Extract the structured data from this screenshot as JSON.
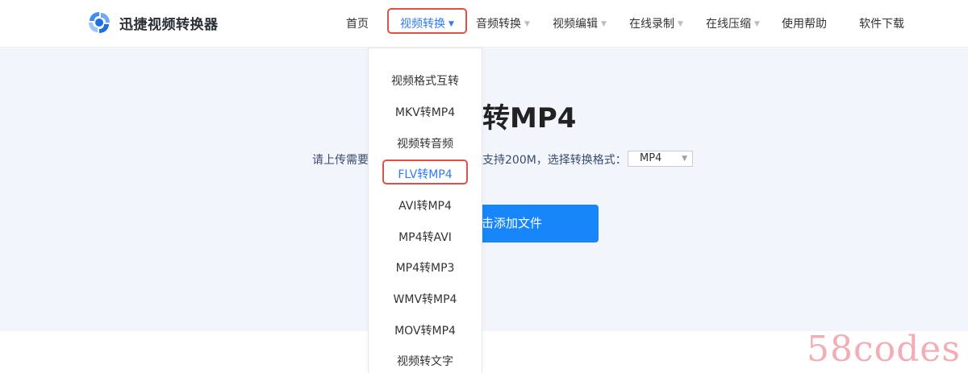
{
  "brand": {
    "name": "迅捷视频转换器",
    "logo_icon": "swirl-logo-icon",
    "accent_color": "#2d7bf0"
  },
  "nav": {
    "items": [
      {
        "label": "首页",
        "has_caret": false,
        "active": false
      },
      {
        "label": "视频转换",
        "has_caret": true,
        "active": true
      },
      {
        "label": "音频转换",
        "has_caret": true,
        "active": false
      },
      {
        "label": "视频编辑",
        "has_caret": true,
        "active": false
      },
      {
        "label": "在线录制",
        "has_caret": true,
        "active": false
      },
      {
        "label": "在线压缩",
        "has_caret": true,
        "active": false
      },
      {
        "label": "使用帮助",
        "has_caret": false,
        "active": false
      },
      {
        "label": "软件下载",
        "has_caret": false,
        "active": false
      }
    ],
    "caret_glyph": "▼"
  },
  "dropdown": {
    "items": [
      {
        "label": "视频格式互转",
        "active": false
      },
      {
        "label": "MKV转MP4",
        "active": false
      },
      {
        "label": "视频转音频",
        "active": false
      },
      {
        "label": "FLV转MP4",
        "active": true
      },
      {
        "label": "AVI转MP4",
        "active": false
      },
      {
        "label": "MP4转AVI",
        "active": false
      },
      {
        "label": "MP4转MP3",
        "active": false
      },
      {
        "label": "WMV转MP4",
        "active": false
      },
      {
        "label": "MOV转MP4",
        "active": false
      },
      {
        "label": "视频转文字",
        "active": false
      }
    ]
  },
  "hero": {
    "title_visible": "转MP4",
    "hint_left_visible": "请上传需要",
    "hint_right_visible": "支持200M，选择转换格式：",
    "format_select": {
      "value": "MP4"
    },
    "add_button_visible": "击添加文件",
    "button_color": "#1786f8",
    "background_color": "#f2f6fc"
  },
  "annotations": {
    "highlight_color": "#e05046"
  },
  "watermark": {
    "text": "58codes"
  }
}
